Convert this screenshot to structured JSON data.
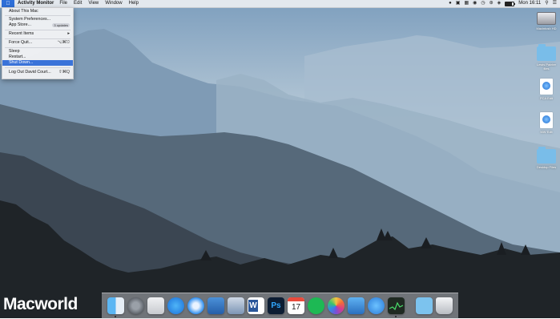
{
  "menubar": {
    "app_name": "Activity Monitor",
    "menus": [
      "File",
      "Edit",
      "View",
      "Window",
      "Help"
    ],
    "clock": "Mon 16:11",
    "battery_fraction": 0.8
  },
  "apple_menu": {
    "about": "About This Mac",
    "system_prefs": "System Preferences...",
    "app_store": "App Store...",
    "app_store_badge": "3 updates",
    "recent_items": "Recent Items",
    "force_quit": "Force Quit...",
    "force_quit_shortcut": "⌥⌘⎋",
    "sleep": "Sleep",
    "restart": "Restart...",
    "shut_down": "Shut Down...",
    "log_out": "Log Out David Court...",
    "log_out_shortcut": "⇧⌘Q"
  },
  "desktop_icons": [
    {
      "label": "Macintosh HD"
    },
    {
      "label": "Lewis Painter files"
    },
    {
      "label": "PCA Edit"
    },
    {
      "label": "MW Edit"
    },
    {
      "label": "Desktop Files"
    }
  ],
  "dock_apps": [
    "Finder",
    "System Preferences",
    "Mail",
    "App Store",
    "Safari",
    "Photo Booth",
    "Preview",
    "Word",
    "Photoshop",
    "Calendar",
    "Spotify",
    "Photos",
    "Tweetbot",
    "Messages",
    "Activity Monitor",
    "Downloads",
    "Trash"
  ],
  "calendar_day": "17",
  "watermark": "Macworld",
  "colors": {
    "menu_highlight": "#3a73d9",
    "apple_menu_active": "#2f6fd8"
  }
}
